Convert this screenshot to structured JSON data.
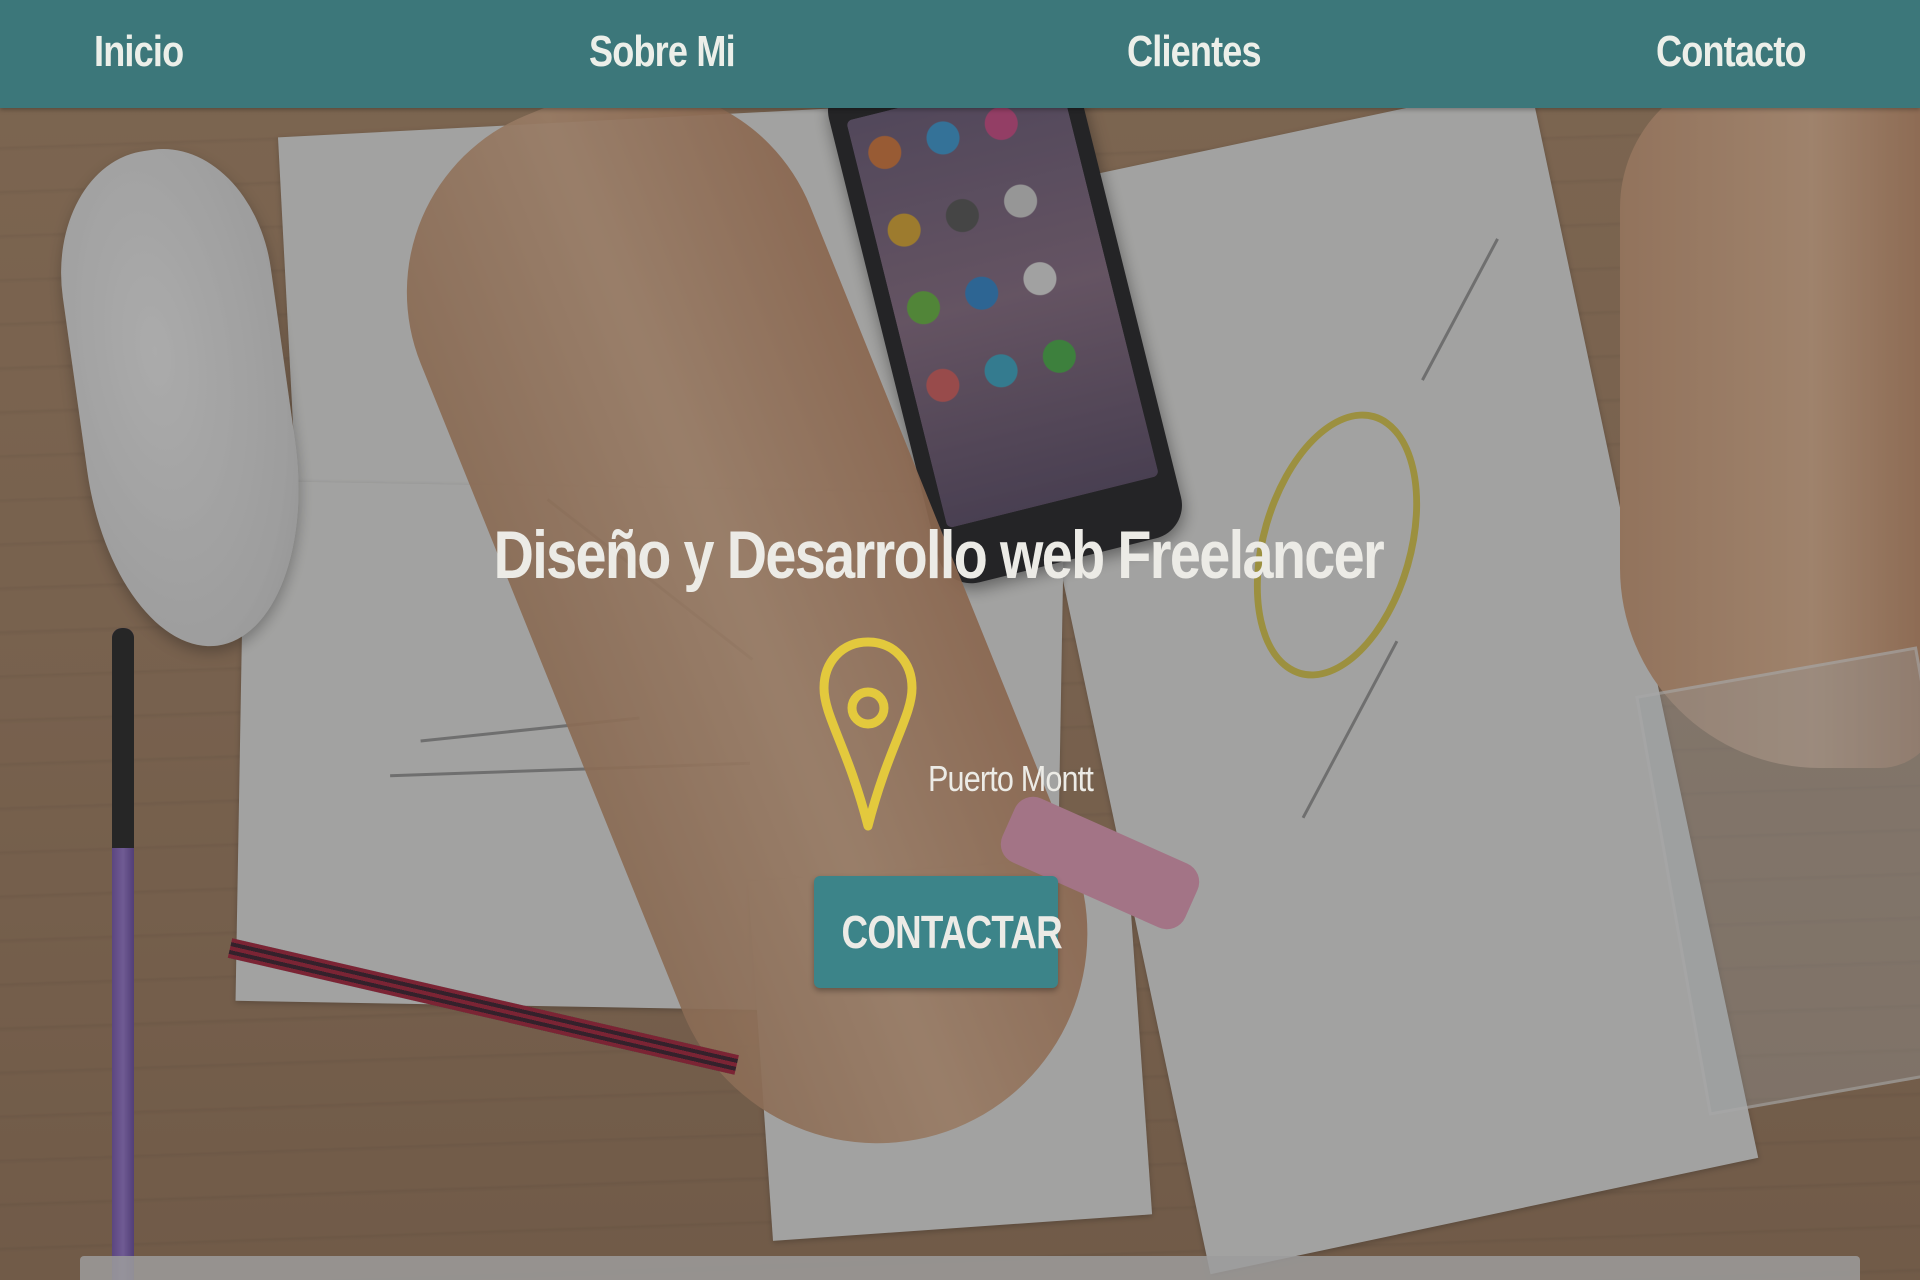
{
  "nav": {
    "items": [
      {
        "label": "Inicio"
      },
      {
        "label": "Sobre Mi"
      },
      {
        "label": "Clientes"
      },
      {
        "label": "Contacto"
      }
    ]
  },
  "hero": {
    "title": "Diseño y Desarrollo web Freelancer",
    "location": "Puerto Montt",
    "location_icon": "map-pin-icon",
    "cta_label": "CONTACTAR"
  },
  "colors": {
    "nav_bg": "#3c777a",
    "cta_bg": "#3c8489",
    "pin_color": "#e3c93d",
    "text_light": "#ecebe6"
  }
}
